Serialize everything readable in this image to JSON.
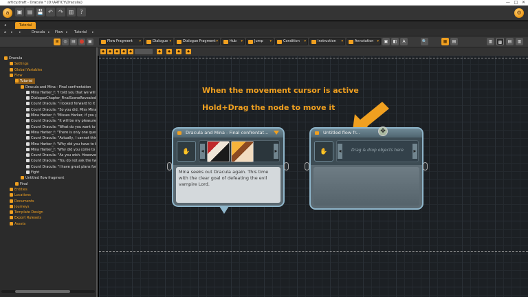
{
  "window": {
    "title": "articy:draft - Dracula * (D:\\ARTICY\\Dracula\\)",
    "controls": [
      "—",
      "□",
      "✕"
    ]
  },
  "appbar": {
    "orb_glyph": "a",
    "right_orb_glyph": "⚙",
    "buttons": [
      "▣",
      "▤",
      "💾",
      "↶",
      "↷",
      "▥",
      "?"
    ]
  },
  "tabs": {
    "arrow": "◂",
    "document_tab": "Tutorial"
  },
  "breadcrumb": {
    "home": "⌂",
    "items": [
      "Dracula",
      "Flow",
      "Tutorial"
    ],
    "separator": "▸"
  },
  "toolbar": {
    "tools": [
      {
        "label": "Flow Fragment"
      },
      {
        "label": "Dialogue"
      },
      {
        "label": "Dialogue Fragment"
      },
      {
        "label": "Hub"
      },
      {
        "label": "Jump"
      },
      {
        "label": "Condition"
      },
      {
        "label": "Instruction"
      },
      {
        "label": "Annotation"
      }
    ],
    "dropdown_arrow": "▾",
    "right_glyphs": [
      "▣",
      "◧",
      "A",
      "🔍",
      "▦",
      "▤",
      "▥",
      "▩"
    ],
    "subbar_glyphs": [
      "◆",
      "◆",
      "◆",
      "◆",
      "◆",
      "◆",
      "◆",
      "◆",
      "◆"
    ],
    "left_glyphs": [
      "⊞",
      "◎",
      "▤",
      "⬤",
      "▣"
    ]
  },
  "tree": {
    "items": [
      {
        "label": "Dracula",
        "level": 0
      },
      {
        "label": "Settings",
        "level": 1,
        "folder": true
      },
      {
        "label": "Global Variables",
        "level": 1,
        "folder": true
      },
      {
        "label": "Flow",
        "level": 1,
        "folder": true
      },
      {
        "label": "Tutorial",
        "level": 2,
        "selected": true
      },
      {
        "label": "Dracula and Mina - Final confrontation",
        "level": 3
      },
      {
        "label": "Mina Harker_f: \"I told you that we will meet a",
        "level": 4
      },
      {
        "label": "DialogueChapter_FinalSceneRevealed ...",
        "level": 4
      },
      {
        "label": "Count Dracula: \"I looked forward to it Miss M",
        "level": 4
      },
      {
        "label": "Count Dracula: \"So you did, Miss Mina.  Don",
        "level": 4
      },
      {
        "label": "Mina Harker_f: \"Misses Harker, if you please.",
        "level": 4
      },
      {
        "label": "Count Dracula: \"It will be my pleasure. But I",
        "level": 4
      },
      {
        "label": "Count Dracula: \"What do you want to know?",
        "level": 4
      },
      {
        "label": "Mina Harker_f: \"There is only one question I",
        "level": 4
      },
      {
        "label": "Count Dracula: \"Actually, I cannot think of an",
        "level": 4
      },
      {
        "label": "Mina Harker_f: \"Why did you have to kill my",
        "level": 4
      },
      {
        "label": "Mina Harker_f: \"Why did you come to Londo",
        "level": 4
      },
      {
        "label": "Count Dracula: \"As you wish. However, I am",
        "level": 4
      },
      {
        "label": "Count Dracula: \"You do not ask the two why",
        "level": 4
      },
      {
        "label": "Count Dracula: \"I have great plans for this cit",
        "level": 4
      },
      {
        "label": "Fight",
        "level": 4
      },
      {
        "label": "Untitled flow fragment",
        "level": 3
      },
      {
        "label": "Final",
        "level": 2
      },
      {
        "label": "Entities",
        "level": 1,
        "folder": true
      },
      {
        "label": "Locations",
        "level": 1,
        "folder": true
      },
      {
        "label": "Documents",
        "level": 1,
        "folder": true
      },
      {
        "label": "Journeys",
        "level": 1,
        "folder": true
      },
      {
        "label": "Template Design",
        "level": 1,
        "folder": true
      },
      {
        "label": "Export Rulesets",
        "level": 1,
        "folder": true
      },
      {
        "label": "Assets",
        "level": 1,
        "folder": true
      }
    ]
  },
  "canvas": {
    "instruction_line1": "When the movement cursor is active",
    "instruction_line2": "Hold+Drag the node to move it"
  },
  "nodes": {
    "dracula": {
      "title": "Dracula and Mina - Final confrontat...",
      "text": "Mina seeks out Dracula again. This time with the clear goal of defeating the evil vampire Lord.",
      "speaker_glyph": "✋",
      "left_chevron": "◂",
      "right_chevron": "▸"
    },
    "untitled": {
      "title": "Untitled flow fr...",
      "drop_hint": "Drag & drop objects here",
      "speaker_glyph": "✋",
      "left_chevron": "◂",
      "right_chevron": "▸"
    }
  },
  "cursor": {
    "glyph": "✥"
  },
  "colors": {
    "accent": "#f0a020",
    "node_border": "#8fb6cb",
    "canvas_bg": "#1c2024",
    "selected_tree_bg": "#8a5a18"
  }
}
